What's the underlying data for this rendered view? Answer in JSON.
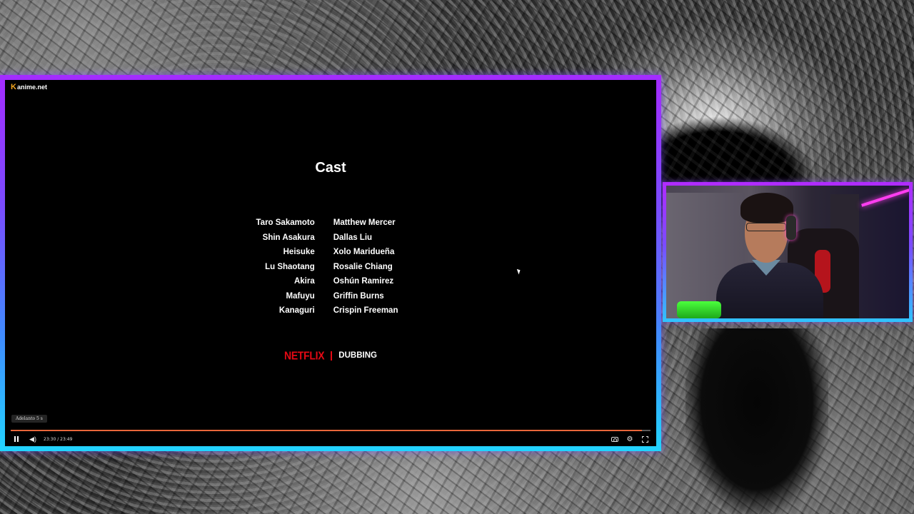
{
  "player": {
    "site_logo": "anime.net",
    "site_logo_mark": "K",
    "credits_title": "Cast",
    "cast_characters": [
      "Taro Sakamoto",
      "Shin Asakura",
      "Heisuke",
      "Lu Shaotang",
      "Akira",
      "Mafuyu",
      "Kanaguri"
    ],
    "cast_actors": [
      "Matthew Mercer",
      "Dallas Liu",
      "Xolo Maridueña",
      "Rosalie Chiang",
      "Oshún Ramirez",
      "Griffin Burns",
      "Crispin Freeman"
    ],
    "brand_netflix": "NETFLIX",
    "brand_dubbing": "DUBBING",
    "tooltip": "Adelanto 5 s",
    "time_display": "23:30 / 23:49",
    "progress_fraction": 0.9867
  },
  "icons": {
    "pause": "pause-icon",
    "volume": "volume-icon",
    "screenshot": "camera-icon",
    "settings": "gear-icon",
    "fullscreen": "fullscreen-icon"
  },
  "colors": {
    "frame_top": "#a42bff",
    "frame_bottom": "#22d4ff",
    "progress": "#e8663a",
    "netflix_red": "#e50914"
  }
}
